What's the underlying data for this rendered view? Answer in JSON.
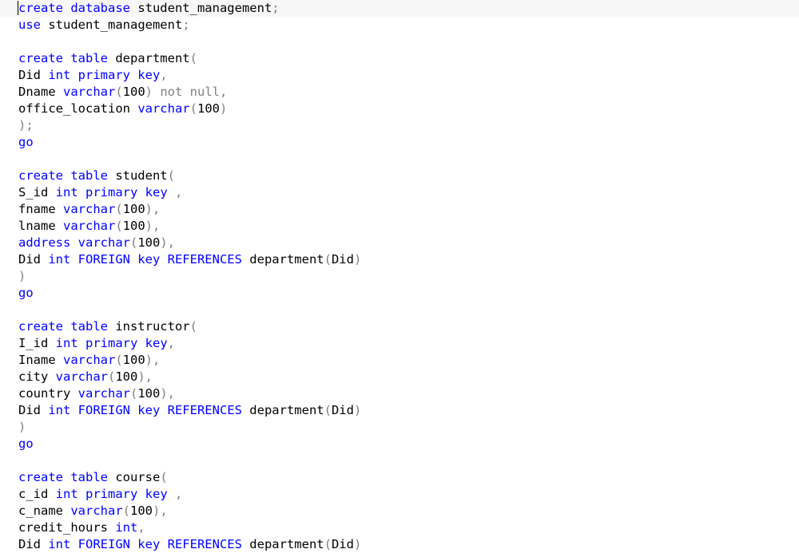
{
  "editor": {
    "current_line": 0,
    "colors": {
      "keyword": "#0000ff",
      "operator": "#808080",
      "identifier": "#000000",
      "current_line_background": "#f7f7f7"
    },
    "lines": [
      [
        [
          "kw",
          "create database"
        ],
        [
          "id",
          " student_management"
        ],
        [
          "op",
          ";"
        ]
      ],
      [
        [
          "kw",
          "use"
        ],
        [
          "id",
          " student_management"
        ],
        [
          "op",
          ";"
        ]
      ],
      [],
      [
        [
          "kw",
          "create table"
        ],
        [
          "id",
          " department"
        ],
        [
          "op",
          "("
        ]
      ],
      [
        [
          "id",
          "Did "
        ],
        [
          "kw",
          "int primary key"
        ],
        [
          "op",
          ","
        ]
      ],
      [
        [
          "id",
          "Dname "
        ],
        [
          "kw",
          "varchar"
        ],
        [
          "op",
          "("
        ],
        [
          "id",
          "100"
        ],
        [
          "op",
          ") not null,"
        ]
      ],
      [
        [
          "id",
          "office_location "
        ],
        [
          "kw",
          "varchar"
        ],
        [
          "op",
          "("
        ],
        [
          "id",
          "100"
        ],
        [
          "op",
          ")"
        ]
      ],
      [
        [
          "op",
          ");"
        ]
      ],
      [
        [
          "kw",
          "go"
        ]
      ],
      [],
      [
        [
          "kw",
          "create table"
        ],
        [
          "id",
          " student"
        ],
        [
          "op",
          "("
        ]
      ],
      [
        [
          "id",
          "S_id "
        ],
        [
          "kw",
          "int primary key"
        ],
        [
          "op",
          " ,"
        ]
      ],
      [
        [
          "id",
          "fname "
        ],
        [
          "kw",
          "varchar"
        ],
        [
          "op",
          "("
        ],
        [
          "id",
          "100"
        ],
        [
          "op",
          "),"
        ]
      ],
      [
        [
          "id",
          "lname "
        ],
        [
          "kw",
          "varchar"
        ],
        [
          "op",
          "("
        ],
        [
          "id",
          "100"
        ],
        [
          "op",
          "),"
        ]
      ],
      [
        [
          "kw",
          "address varchar"
        ],
        [
          "op",
          "("
        ],
        [
          "id",
          "100"
        ],
        [
          "op",
          "),"
        ]
      ],
      [
        [
          "id",
          "Did "
        ],
        [
          "kw",
          "int FOREIGN key REFERENCES"
        ],
        [
          "id",
          " department"
        ],
        [
          "op",
          "("
        ],
        [
          "id",
          "Did"
        ],
        [
          "op",
          ")"
        ]
      ],
      [
        [
          "op",
          ")"
        ]
      ],
      [
        [
          "kw",
          "go"
        ]
      ],
      [],
      [
        [
          "kw",
          "create table"
        ],
        [
          "id",
          " instructor"
        ],
        [
          "op",
          "("
        ]
      ],
      [
        [
          "id",
          "I_id "
        ],
        [
          "kw",
          "int primary key"
        ],
        [
          "op",
          ","
        ]
      ],
      [
        [
          "id",
          "Iname "
        ],
        [
          "kw",
          "varchar"
        ],
        [
          "op",
          "("
        ],
        [
          "id",
          "100"
        ],
        [
          "op",
          "),"
        ]
      ],
      [
        [
          "id",
          "city "
        ],
        [
          "kw",
          "varchar"
        ],
        [
          "op",
          "("
        ],
        [
          "id",
          "100"
        ],
        [
          "op",
          "),"
        ]
      ],
      [
        [
          "id",
          "country "
        ],
        [
          "kw",
          "varchar"
        ],
        [
          "op",
          "("
        ],
        [
          "id",
          "100"
        ],
        [
          "op",
          "),"
        ]
      ],
      [
        [
          "id",
          "Did "
        ],
        [
          "kw",
          "int FOREIGN key REFERENCES"
        ],
        [
          "id",
          " department"
        ],
        [
          "op",
          "("
        ],
        [
          "id",
          "Did"
        ],
        [
          "op",
          ")"
        ]
      ],
      [
        [
          "op",
          ")"
        ]
      ],
      [
        [
          "kw",
          "go"
        ]
      ],
      [],
      [
        [
          "kw",
          "create table"
        ],
        [
          "id",
          " course"
        ],
        [
          "op",
          "("
        ]
      ],
      [
        [
          "id",
          "c_id "
        ],
        [
          "kw",
          "int primary key"
        ],
        [
          "op",
          " ,"
        ]
      ],
      [
        [
          "id",
          "c_name "
        ],
        [
          "kw",
          "varchar"
        ],
        [
          "op",
          "("
        ],
        [
          "id",
          "100"
        ],
        [
          "op",
          "),"
        ]
      ],
      [
        [
          "id",
          "credit_hours "
        ],
        [
          "kw",
          "int"
        ],
        [
          "op",
          ","
        ]
      ],
      [
        [
          "id",
          "Did "
        ],
        [
          "kw",
          "int FOREIGN key REFERENCES"
        ],
        [
          "id",
          " department"
        ],
        [
          "op",
          "("
        ],
        [
          "id",
          "Did"
        ],
        [
          "op",
          ")"
        ]
      ]
    ]
  }
}
